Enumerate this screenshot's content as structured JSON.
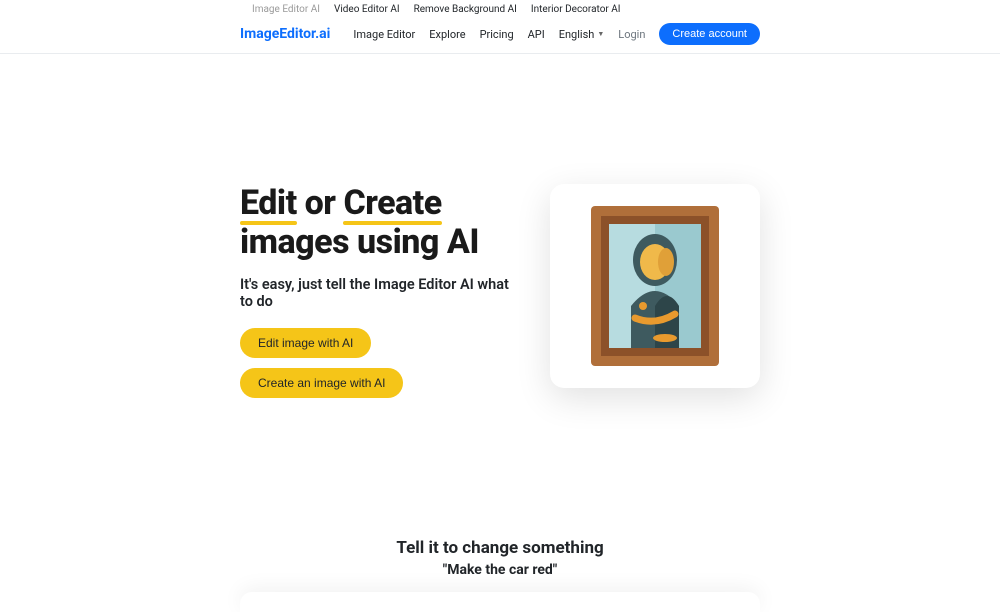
{
  "topLinks": {
    "imageEditor": "Image Editor AI",
    "videoEditor": "Video Editor AI",
    "removeBg": "Remove Background AI",
    "interior": "Interior Decorator AI"
  },
  "brand": "ImageEditor.ai",
  "nav": {
    "imageEditor": "Image Editor",
    "explore": "Explore",
    "pricing": "Pricing",
    "api": "API",
    "language": "English",
    "login": "Login",
    "createAccount": "Create account"
  },
  "hero": {
    "title_part1": "Edit",
    "title_part2": " or ",
    "title_part3": "Create",
    "title_part4": " images using AI",
    "subtitle": "It's easy, just tell the Image Editor AI what to do",
    "cta_edit": "Edit image with AI",
    "cta_create": "Create an image with AI"
  },
  "section2": {
    "title": "Tell it to change something",
    "quote": "\"Make the car red\""
  },
  "colors": {
    "accent": "#0d6efd",
    "highlight": "#f5c518"
  }
}
